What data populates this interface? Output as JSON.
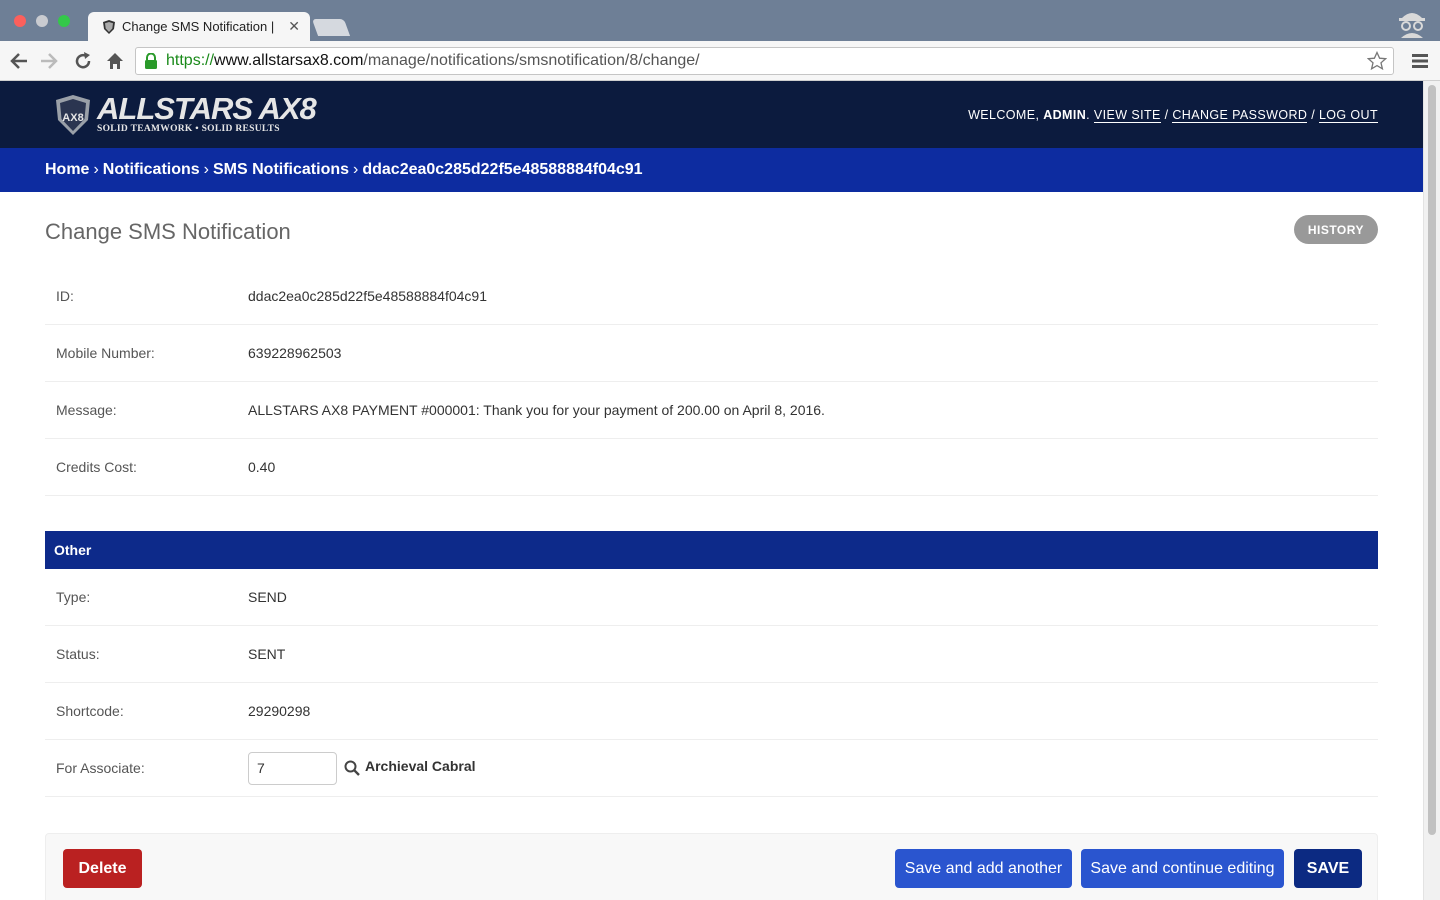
{
  "browser": {
    "tab_title": "Change SMS Notification |",
    "url_scheme": "https://",
    "url_host": "www.allstarsax8.com",
    "url_path": "/manage/notifications/smsnotification/8/change/"
  },
  "header": {
    "logo_name": "ALLSTARS AX8",
    "logo_tagline": "SOLID TEAMWORK • SOLID RESULTS",
    "welcome": "WELCOME,",
    "username": "ADMIN",
    "view_site": "VIEW SITE",
    "change_password": "CHANGE PASSWORD",
    "log_out": "LOG OUT",
    "sep": "/"
  },
  "breadcrumbs": {
    "home": "Home",
    "notifications": "Notifications",
    "sms_notifications": "SMS Notifications",
    "current": "ddac2ea0c285d22f5e48588884f04c91",
    "sep": "›"
  },
  "page": {
    "title": "Change SMS Notification",
    "history_label": "HISTORY"
  },
  "fields": [
    {
      "label": "ID:",
      "value": "ddac2ea0c285d22f5e48588884f04c91"
    },
    {
      "label": "Mobile Number:",
      "value": "639228962503"
    },
    {
      "label": "Message:",
      "value": "ALLSTARS AX8 PAYMENT #000001: Thank you for your payment of 200.00 on April 8, 2016."
    },
    {
      "label": "Credits Cost:",
      "value": "0.40"
    }
  ],
  "other": {
    "heading": "Other",
    "fields": [
      {
        "label": "Type:",
        "value": "SEND"
      },
      {
        "label": "Status:",
        "value": "SENT"
      },
      {
        "label": "Shortcode:",
        "value": "29290298"
      }
    ],
    "associate_label": "For Associate:",
    "associate_id": "7",
    "associate_name": "Archieval Cabral"
  },
  "actions": {
    "delete": "Delete",
    "save_add_another": "Save and add another",
    "save_continue": "Save and continue editing",
    "save": "SAVE"
  },
  "colors": {
    "header_bg": "#0c1b3e",
    "breadcrumb_bg": "#0d2ca0",
    "fieldset_bg": "#0d2a8a",
    "delete_bg": "#ba2121",
    "primary_btn": "#2a55cf",
    "save_btn": "#0c2a82"
  }
}
